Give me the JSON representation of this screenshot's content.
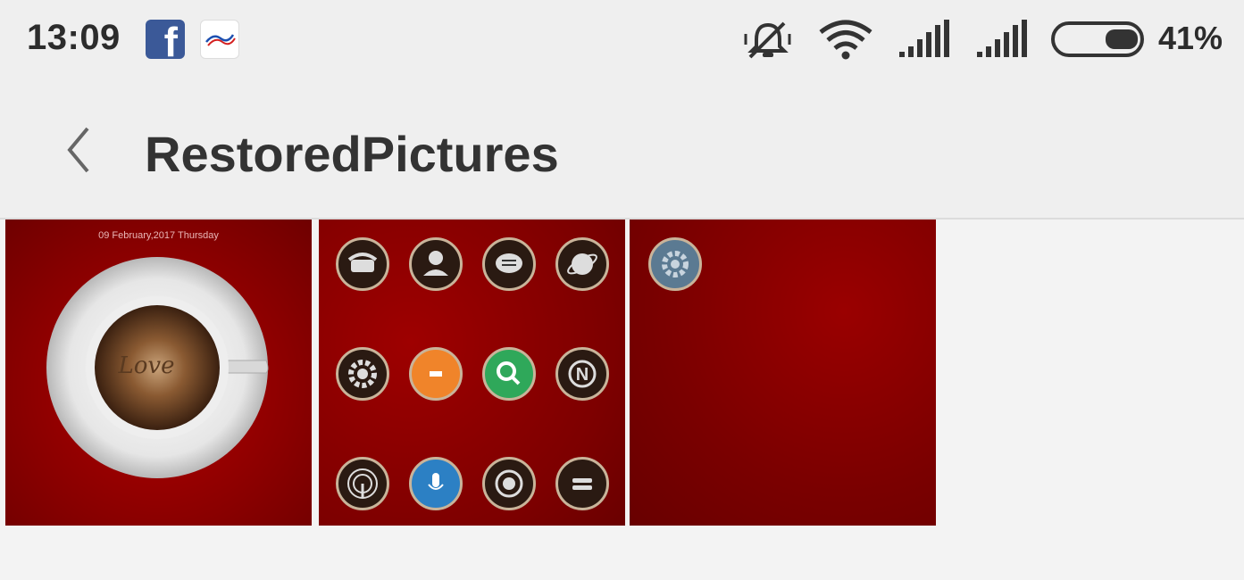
{
  "status_bar": {
    "time": "13:09",
    "battery_percent": "41%",
    "icons": [
      "facebook-icon",
      "tv-app-icon",
      "mute-icon",
      "wifi-icon",
      "signal-icon",
      "signal-icon",
      "battery-icon"
    ]
  },
  "header": {
    "title": "RestoredPictures",
    "back_icon": "chevron-left-icon"
  },
  "gallery": {
    "thumbnails": [
      {
        "name": "coffee-love-wallpaper",
        "date_text": "09 February,2017  Thursday",
        "cup_text": "Love"
      },
      {
        "name": "app-icons-theme",
        "icons": [
          "phone-icon",
          "contacts-icon",
          "messages-icon",
          "browser-icon",
          "settings-icon",
          "mi-icon",
          "search-icon",
          "notes-icon",
          "radio-icon",
          "mic-icon",
          "camera-icon",
          "menu-icon"
        ]
      },
      {
        "name": "red-wallpaper-gear",
        "icons": [
          "gear-icon"
        ]
      }
    ]
  },
  "colors": {
    "accent_red": "#8a0000",
    "background": "#f3f3f3",
    "bar": "#efefef"
  }
}
